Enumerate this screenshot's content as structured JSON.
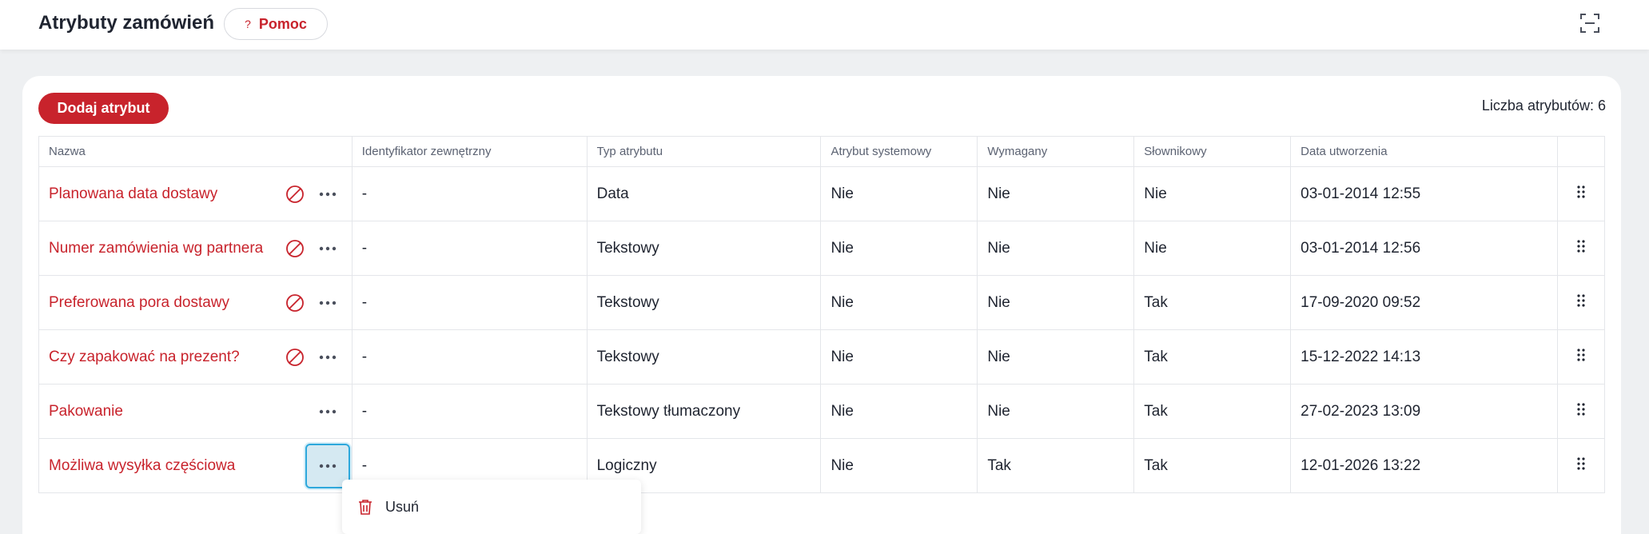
{
  "header": {
    "title": "Atrybuty zamówień",
    "help_icon": "?",
    "help_label": "Pomoc"
  },
  "toolbar": {
    "add_label": "Dodaj atrybut",
    "count_text": "Liczba atrybutów: 6"
  },
  "table": {
    "columns": [
      "Nazwa",
      "Identyfikator zewnętrzny",
      "Typ atrybutu",
      "Atrybut systemowy",
      "Wymagany",
      "Słownikowy",
      "Data utworzenia"
    ],
    "rows": [
      {
        "name": "Planowana data dostawy",
        "external_id": "-",
        "type": "Data",
        "system": "Nie",
        "required": "Nie",
        "dictionary": "Nie",
        "created": "03-01-2014 12:55"
      },
      {
        "name": "Numer zamówienia wg partnera",
        "external_id": "-",
        "type": "Tekstowy",
        "system": "Nie",
        "required": "Nie",
        "dictionary": "Nie",
        "created": "03-01-2014 12:56"
      },
      {
        "name": "Preferowana pora dostawy",
        "external_id": "-",
        "type": "Tekstowy",
        "system": "Nie",
        "required": "Nie",
        "dictionary": "Tak",
        "created": "17-09-2020 09:52"
      },
      {
        "name": "Czy zapakować na prezent?",
        "external_id": "-",
        "type": "Tekstowy",
        "system": "Nie",
        "required": "Nie",
        "dictionary": "Tak",
        "created": "15-12-2022 14:13"
      },
      {
        "name": "Pakowanie",
        "external_id": "-",
        "type": "Tekstowy tłumaczony",
        "system": "Nie",
        "required": "Nie",
        "dictionary": "Tak",
        "created": "27-02-2023 13:09"
      },
      {
        "name": "Możliwa wysyłka częściowa",
        "external_id": "-",
        "type": "Logiczny",
        "system": "Nie",
        "required": "Tak",
        "dictionary": "Tak",
        "created": "12-01-2026 13:22"
      }
    ]
  },
  "context_menu": {
    "delete_label": "Usuń"
  },
  "colors": {
    "brand": "#c8232c",
    "focus": "#2ea8dc"
  }
}
